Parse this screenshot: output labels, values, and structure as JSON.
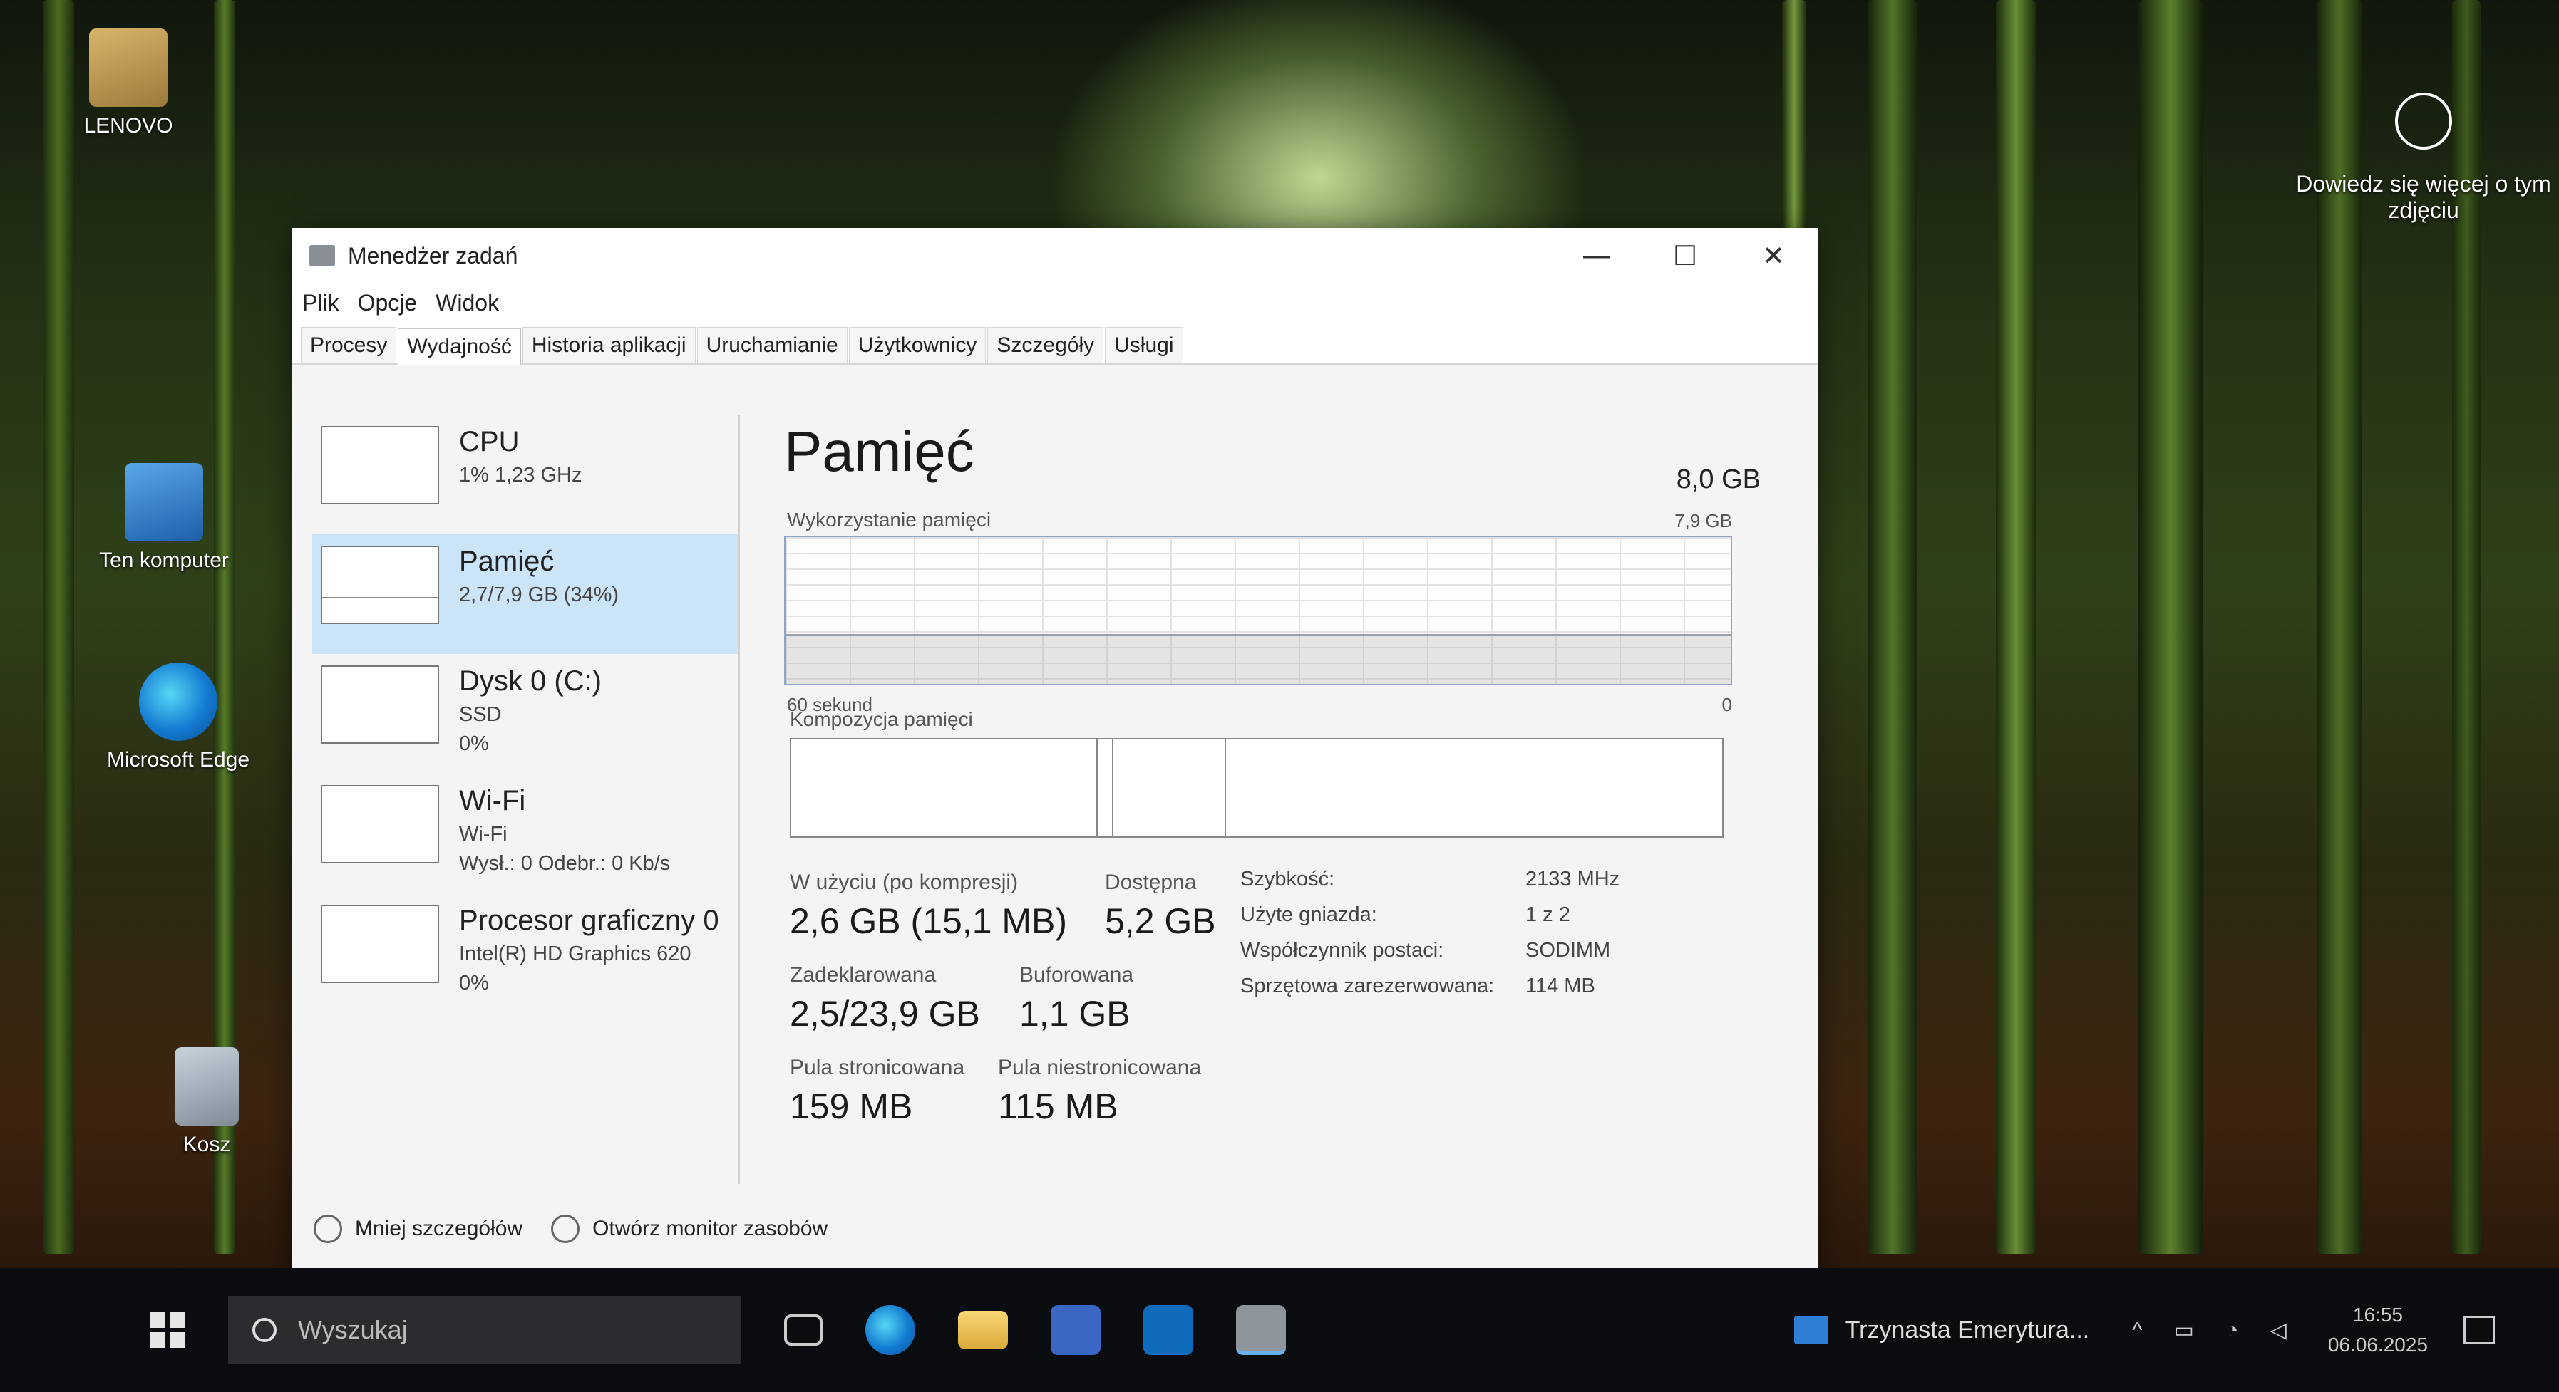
{
  "desktop": {
    "icons": [
      {
        "label": "LENOVO"
      },
      {
        "label": "Ten komputer"
      },
      {
        "label": "Microsoft Edge"
      },
      {
        "label": "Kosz"
      }
    ],
    "learn_more": "Dowiedz się więcej o tym zdjęciu"
  },
  "window": {
    "title": "Menedżer zadań",
    "menu": [
      "Plik",
      "Opcje",
      "Widok"
    ],
    "tabs": [
      "Procesy",
      "Wydajność",
      "Historia aplikacji",
      "Uruchamianie",
      "Użytkownicy",
      "Szczegóły",
      "Usługi"
    ],
    "active_tab": "Wydajność"
  },
  "perf_list": [
    {
      "name": "CPU",
      "line1": "1% 1,23 GHz",
      "line2": ""
    },
    {
      "name": "Pamięć",
      "line1": "2,7/7,9 GB (34%)",
      "line2": ""
    },
    {
      "name": "Dysk 0 (C:)",
      "line1": "SSD",
      "line2": "0%"
    },
    {
      "name": "Wi-Fi",
      "line1": "Wi-Fi",
      "line2": "Wysł.: 0 Odebr.: 0 Kb/s"
    },
    {
      "name": "Procesor graficzny 0",
      "line1": "Intel(R) HD Graphics 620",
      "line2": "0%"
    }
  ],
  "memory": {
    "title": "Pamięć",
    "total": "8,0 GB",
    "usage_label": "Wykorzystanie pamięci",
    "graph_max": "7,9 GB",
    "graph_time": "60 sekund",
    "graph_min": "0",
    "usage_fraction": 0.34,
    "composition_label": "Kompozycja pamięci",
    "stats": {
      "in_use_label": "W użyciu (po kompresji)",
      "in_use_value": "2,6 GB (15,1 MB)",
      "available_label": "Dostępna",
      "available_value": "5,2 GB",
      "committed_label": "Zadeklarowana",
      "committed_value": "2,5/23,9 GB",
      "cached_label": "Buforowana",
      "cached_value": "1,1 GB",
      "paged_label": "Pula stronicowana",
      "paged_value": "159 MB",
      "nonpaged_label": "Pula niestronicowana",
      "nonpaged_value": "115 MB"
    },
    "specs": [
      {
        "k": "Szybkość:",
        "v": "2133 MHz"
      },
      {
        "k": "Użyte gniazda:",
        "v": "1 z 2"
      },
      {
        "k": "Współczynnik postaci:",
        "v": "SODIMM"
      },
      {
        "k": "Sprzętowa zarezerwowana:",
        "v": "114 MB"
      }
    ]
  },
  "footer": {
    "fewer_details": "Mniej szczegółów",
    "open_monitor": "Otwórz monitor zasobów"
  },
  "taskbar": {
    "search_placeholder": "Wyszukaj",
    "notification": "Trzynasta Emerytura...",
    "time": "16:55",
    "date": "06.06.2025"
  }
}
